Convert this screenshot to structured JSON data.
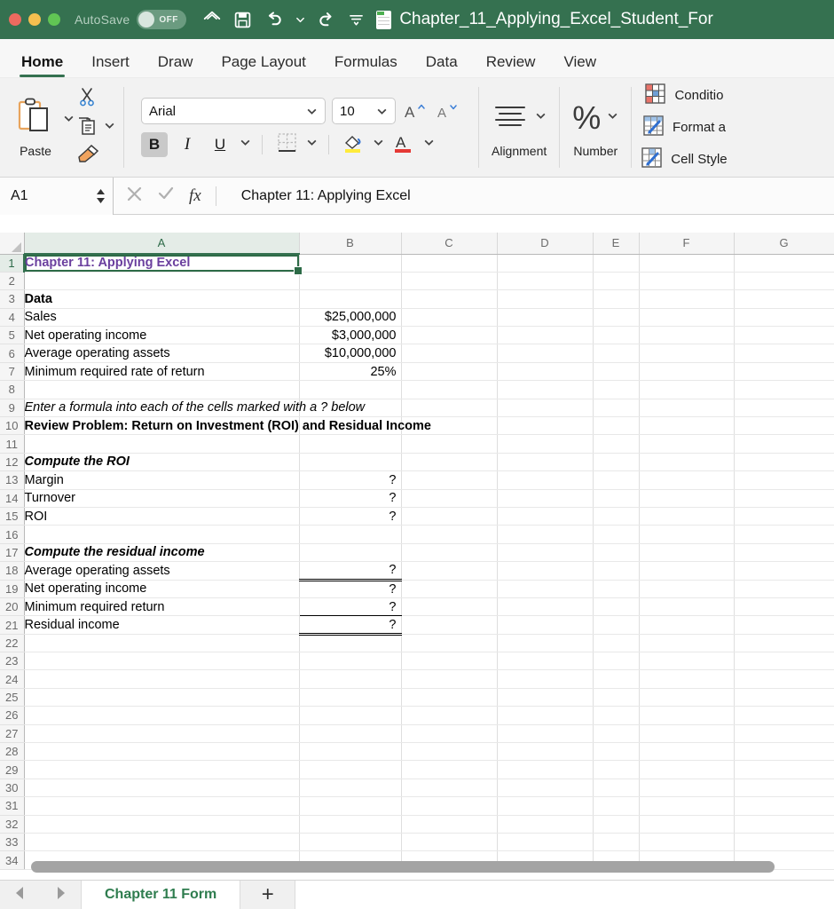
{
  "titlebar": {
    "autosave_label": "AutoSave",
    "autosave_state": "OFF",
    "document_title": "Chapter_11_Applying_Excel_Student_For",
    "background_color": "#357150",
    "quick_access": [
      "home-icon",
      "save-icon",
      "undo-icon",
      "redo-icon",
      "customize-icon"
    ]
  },
  "ribbon_tabs": [
    {
      "label": "Home",
      "active": true
    },
    {
      "label": "Insert",
      "active": false
    },
    {
      "label": "Draw",
      "active": false
    },
    {
      "label": "Page Layout",
      "active": false
    },
    {
      "label": "Formulas",
      "active": false
    },
    {
      "label": "Data",
      "active": false
    },
    {
      "label": "Review",
      "active": false
    },
    {
      "label": "View",
      "active": false
    }
  ],
  "ribbon": {
    "clipboard": {
      "paste_label": "Paste"
    },
    "font": {
      "font_name": "Arial",
      "font_size": "10",
      "bold_label": "B",
      "italic_label": "I",
      "underline_label": "U",
      "bold_active": true
    },
    "alignment": {
      "label": "Alignment"
    },
    "number": {
      "label": "Number",
      "symbol": "%"
    },
    "styles": [
      {
        "label": "Conditio",
        "icon": "conditional-formatting-icon"
      },
      {
        "label": "Format a",
        "icon": "format-as-table-icon"
      },
      {
        "label": "Cell Style",
        "icon": "cell-styles-icon"
      }
    ]
  },
  "formula_bar": {
    "name_box": "A1",
    "cancel_icon": "close-icon",
    "enter_icon": "check-icon",
    "fx_label": "fx",
    "content": "Chapter 11: Applying Excel"
  },
  "grid": {
    "columns": [
      "A",
      "B",
      "C",
      "D",
      "E",
      "F",
      "G"
    ],
    "selected_column": "A",
    "selected_row": 1,
    "selected_cell": "A1",
    "row_count": 34,
    "rows": [
      {
        "n": 1,
        "a": "Chapter 11: Applying Excel",
        "b": "",
        "a_style": "purple-bold",
        "selected": true
      },
      {
        "n": 2,
        "a": "",
        "b": ""
      },
      {
        "n": 3,
        "a": "Data",
        "b": "",
        "a_style": "bold"
      },
      {
        "n": 4,
        "a": "Sales",
        "b": "$25,000,000",
        "b_align": "right"
      },
      {
        "n": 5,
        "a": "Net operating income",
        "b": "$3,000,000",
        "b_align": "right"
      },
      {
        "n": 6,
        "a": "Average operating assets",
        "b": "$10,000,000",
        "b_align": "right"
      },
      {
        "n": 7,
        "a": "Minimum required rate of return",
        "b": "25%",
        "b_align": "right"
      },
      {
        "n": 8,
        "a": "",
        "b": ""
      },
      {
        "n": 9,
        "a": "Enter a formula into each of the cells marked with a ? below",
        "b": "",
        "a_style": "italic",
        "overflow": true
      },
      {
        "n": 10,
        "a": "Review Problem: Return on Investment (ROI) and Residual Income",
        "b": "",
        "a_style": "bold",
        "overflow": true
      },
      {
        "n": 11,
        "a": "",
        "b": ""
      },
      {
        "n": 12,
        "a": "Compute the ROI",
        "b": "",
        "a_style": "bold-italic"
      },
      {
        "n": 13,
        "a": "Margin",
        "b": "?",
        "b_align": "right"
      },
      {
        "n": 14,
        "a": "Turnover",
        "b": "?",
        "b_align": "right"
      },
      {
        "n": 15,
        "a": "ROI",
        "b": "?",
        "b_align": "right"
      },
      {
        "n": 16,
        "a": "",
        "b": ""
      },
      {
        "n": 17,
        "a": "Compute the residual income",
        "b": "",
        "a_style": "bold-italic"
      },
      {
        "n": 18,
        "a": "Average operating assets",
        "b": "?",
        "b_align": "right",
        "b_border": "double-bottom"
      },
      {
        "n": 19,
        "a": "Net operating income",
        "b": "?",
        "b_align": "right"
      },
      {
        "n": 20,
        "a": "Minimum required return",
        "b": "?",
        "b_align": "right",
        "b_border": "single-bottom"
      },
      {
        "n": 21,
        "a": "Residual income",
        "b": "?",
        "b_align": "right",
        "b_border": "double-bottom"
      },
      {
        "n": 22,
        "a": "",
        "b": ""
      },
      {
        "n": 23,
        "a": "",
        "b": ""
      },
      {
        "n": 24,
        "a": "",
        "b": ""
      },
      {
        "n": 25,
        "a": "",
        "b": ""
      },
      {
        "n": 26,
        "a": "",
        "b": ""
      },
      {
        "n": 27,
        "a": "",
        "b": ""
      },
      {
        "n": 28,
        "a": "",
        "b": ""
      },
      {
        "n": 29,
        "a": "",
        "b": ""
      },
      {
        "n": 30,
        "a": "",
        "b": ""
      },
      {
        "n": 31,
        "a": "",
        "b": ""
      },
      {
        "n": 32,
        "a": "",
        "b": ""
      },
      {
        "n": 33,
        "a": "",
        "b": ""
      },
      {
        "n": 34,
        "a": "",
        "b": ""
      }
    ]
  },
  "sheet_bar": {
    "prev_icon": "nav-prev-icon",
    "next_icon": "nav-next-icon",
    "tabs": [
      {
        "label": "Chapter 11 Form",
        "active": true,
        "color": "#2f7d4f"
      }
    ],
    "add_sheet_label": "+"
  }
}
